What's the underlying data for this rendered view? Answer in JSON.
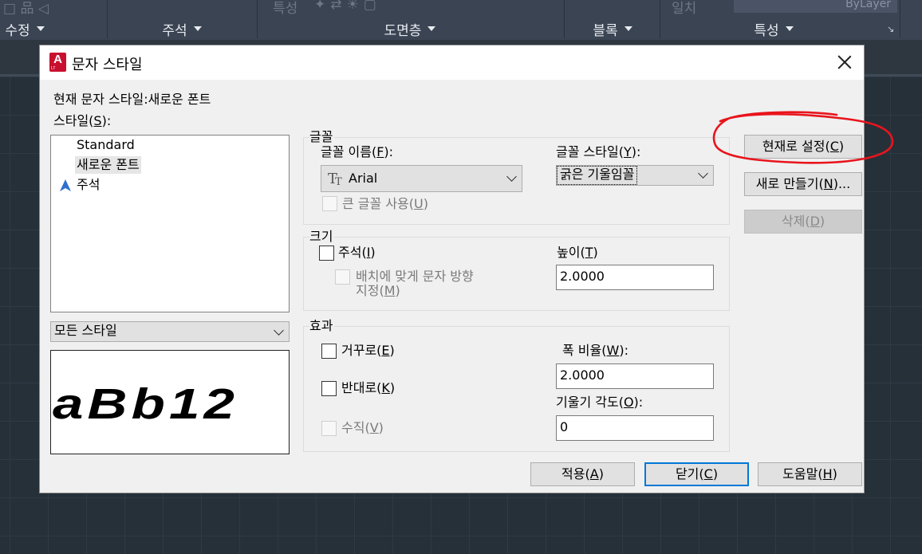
{
  "ribbon": {
    "ghost_left": "□ 品 ◁",
    "ghost_mid": "특성",
    "ghost_layer": "일치",
    "bylayer_value": "ByLayer",
    "panels": [
      "수정",
      "주석",
      "도면층",
      "블록",
      "특성"
    ]
  },
  "dialog": {
    "title": "문자 스타일",
    "current_style_label": "현재 문자 스타일:",
    "current_style_value": "새로운 폰트",
    "styles_label": "스타일",
    "styles_key": "S",
    "styles": [
      "Standard",
      "새로운 폰트",
      "주석"
    ],
    "selected_style_index": 1,
    "filter_select": "모든 스타일",
    "preview_text": "aBb12",
    "font_group": {
      "title": "글꼴",
      "font_name_label": "글꼴 이름",
      "font_name_key": "F",
      "font_name_value": "Arial",
      "font_style_label": "글꼴 스타일",
      "font_style_key": "Y",
      "font_style_value": "굵은 기울임꼴",
      "big_font_label": "큰 글꼴 사용",
      "big_font_key": "U"
    },
    "size_group": {
      "title": "크기",
      "annotative_label": "주석",
      "annotative_key": "I",
      "match_orientation_line1": "배치에 맞게 문자 방향",
      "match_orientation_line2": "지정",
      "match_orientation_key": "M",
      "height_label": "높이",
      "height_key": "T",
      "height_value": "2.0000"
    },
    "effects_group": {
      "title": "효과",
      "upside_down_label": "거꾸로",
      "upside_down_key": "E",
      "backwards_label": "반대로",
      "backwards_key": "K",
      "vertical_label": "수직",
      "vertical_key": "V",
      "width_factor_label": "폭 비율",
      "width_factor_key": "W",
      "width_factor_value": "2.0000",
      "oblique_label": "기울기 각도",
      "oblique_key": "O",
      "oblique_value": "0"
    },
    "buttons": {
      "set_current": "현재로 설정",
      "set_current_key": "C",
      "new": "새로 만들기",
      "new_key": "N",
      "delete": "삭제",
      "delete_key": "D",
      "apply": "적용",
      "apply_key": "A",
      "close": "닫기",
      "close_key": "C",
      "help": "도움말",
      "help_key": "H"
    }
  },
  "colors": {
    "annotation_circle": "#e8141c",
    "default_button_border": "#0078d7",
    "app_icon": "#c8102e"
  }
}
